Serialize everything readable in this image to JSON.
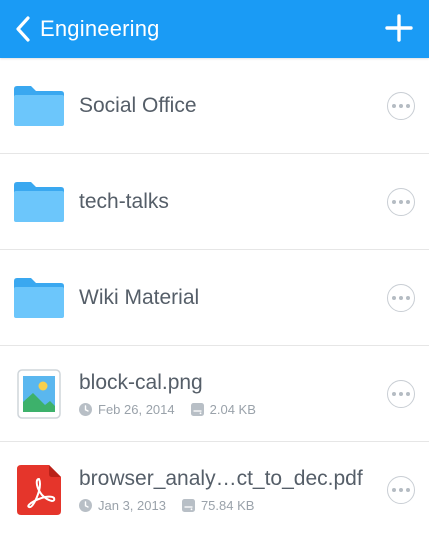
{
  "header": {
    "title": "Engineering",
    "back_icon": "chevron-left-icon",
    "add_icon": "plus-icon",
    "background": "#1a9bf5"
  },
  "items": [
    {
      "type": "folder",
      "icon": "folder-icon",
      "name": "Social Office"
    },
    {
      "type": "folder",
      "icon": "folder-icon",
      "name": "tech-talks"
    },
    {
      "type": "folder",
      "icon": "folder-icon",
      "name": "Wiki Material"
    },
    {
      "type": "image",
      "icon": "image-file-icon",
      "name": "block-cal.png",
      "date": "Feb 26, 2014",
      "size": "2.04 KB"
    },
    {
      "type": "pdf",
      "icon": "pdf-file-icon",
      "name": "browser_analy…ct_to_dec.pdf",
      "date": "Jan 3, 2013",
      "size": "75.84 KB"
    }
  ],
  "colors": {
    "folder": "#5bbdf5",
    "pdf": "#e5352b",
    "text": "#555e68",
    "meta": "#9aa2aa"
  }
}
